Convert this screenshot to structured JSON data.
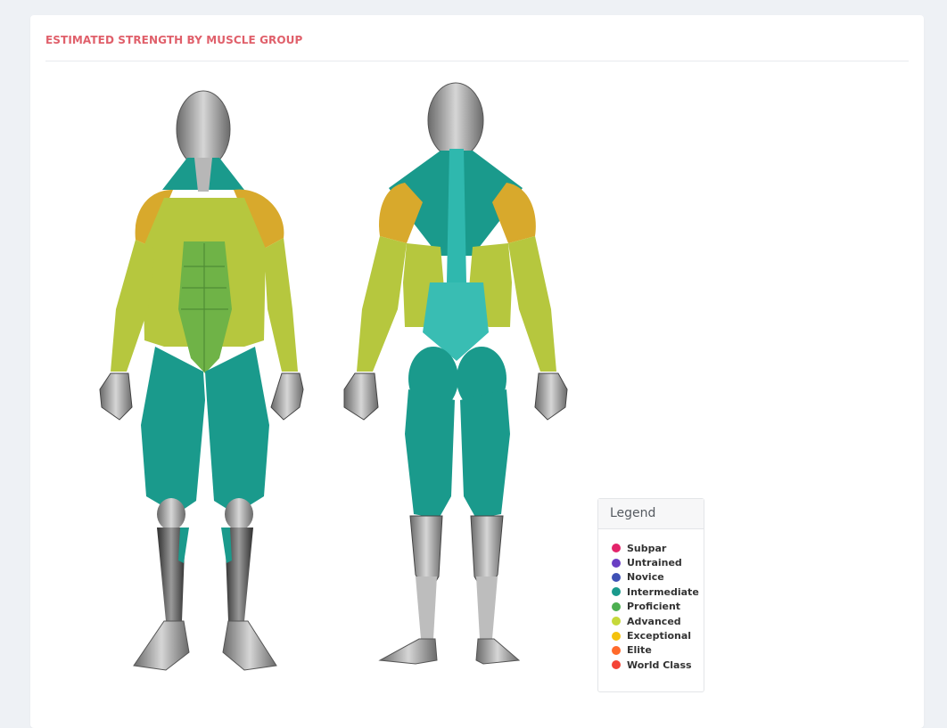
{
  "card": {
    "title": "ESTIMATED STRENGTH BY MUSCLE GROUP"
  },
  "figures": {
    "front_label": "front-body-figure",
    "back_label": "back-body-figure"
  },
  "legend": {
    "title": "Legend",
    "items": [
      {
        "label": "Subpar",
        "color": "#e3246a"
      },
      {
        "label": "Untrained",
        "color": "#6a3fc4"
      },
      {
        "label": "Novice",
        "color": "#3f51b5"
      },
      {
        "label": "Intermediate",
        "color": "#1a9a8c"
      },
      {
        "label": "Proficient",
        "color": "#4caf50"
      },
      {
        "label": "Advanced",
        "color": "#c6d93a"
      },
      {
        "label": "Exceptional",
        "color": "#f4c20d"
      },
      {
        "label": "Elite",
        "color": "#ff6a2b"
      },
      {
        "label": "World Class",
        "color": "#f44336"
      }
    ]
  },
  "muscle_levels": {
    "front": {
      "neck": "Intermediate",
      "shoulders": "Exceptional",
      "chest": "Advanced",
      "biceps_forearms": "Advanced",
      "obliques": "Advanced",
      "abs": "Proficient",
      "quads": "Intermediate",
      "calves": "Intermediate"
    },
    "back": {
      "traps": "Intermediate",
      "rear_delts": "Exceptional",
      "lats": "Advanced",
      "triceps_forearms": "Advanced",
      "lower_back": "Intermediate",
      "glutes": "Intermediate",
      "hamstrings": "Intermediate"
    }
  }
}
